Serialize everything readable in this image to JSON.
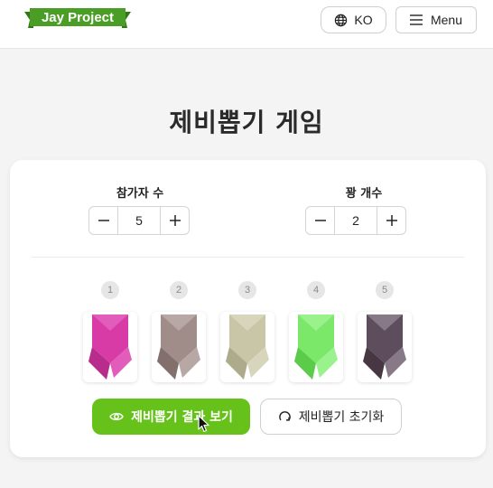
{
  "header": {
    "logo_text": "Jay Project",
    "logo_color": "#4a9d25",
    "language_button": {
      "label": "KO",
      "icon": "globe-icon"
    },
    "menu_button": {
      "label": "Menu",
      "icon": "hamburger-icon"
    }
  },
  "page": {
    "title": "제비뽑기 게임"
  },
  "controls": {
    "participants": {
      "label": "참가자 수",
      "value": "5",
      "decrement": "minus-icon",
      "increment": "plus-icon"
    },
    "losers": {
      "label": "꽝 개수",
      "value": "2",
      "decrement": "minus-icon",
      "increment": "plus-icon"
    }
  },
  "lots": [
    {
      "number": "1",
      "color": "#d83aa6",
      "light": "#e25cbb",
      "dark": "#b82c8c"
    },
    {
      "number": "2",
      "color": "#a08c89",
      "light": "#b8a8a5",
      "dark": "#836f6c"
    },
    {
      "number": "3",
      "color": "#c9c6a8",
      "light": "#d8d5bd",
      "dark": "#aeab8c"
    },
    {
      "number": "4",
      "color": "#7be86a",
      "light": "#9af28c",
      "dark": "#5bcc49"
    },
    {
      "number": "5",
      "color": "#5e4d5c",
      "light": "#877a86",
      "dark": "#463743"
    }
  ],
  "actions": {
    "show_result": {
      "label": "제비뽑기 결과 보기",
      "icon": "eye-icon",
      "color": "#66c21a"
    },
    "reset": {
      "label": "제비뽑기 초기화",
      "icon": "refresh-icon"
    }
  }
}
